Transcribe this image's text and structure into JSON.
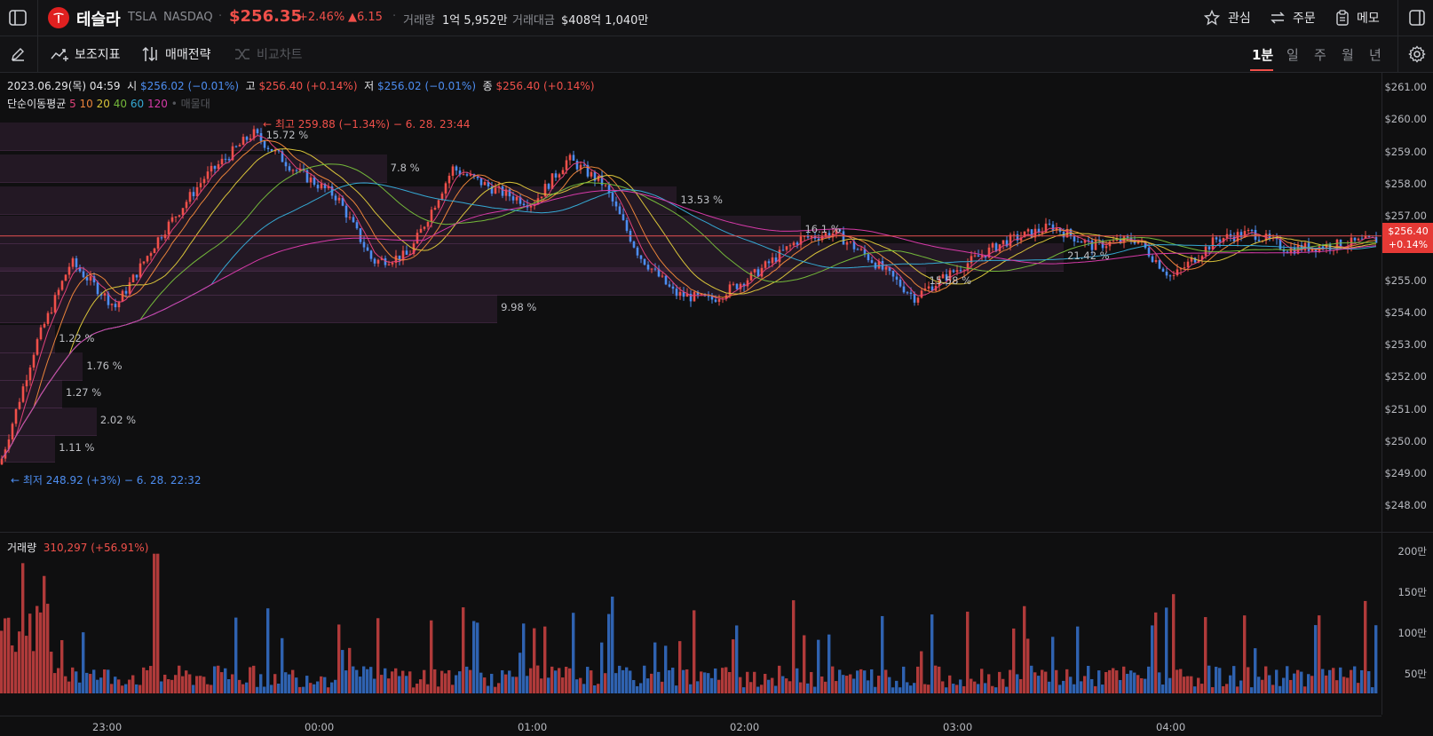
{
  "header": {
    "name": "테슬라",
    "ticker": "TSLA",
    "exchange": "NASDAQ",
    "price": "$256.35",
    "change_pct": "+2.46%",
    "change_abs": "▲6.15",
    "volume_label": "거래량",
    "volume_value": "1억 5,952만",
    "amount_label": "거래대금",
    "amount_value": "$408억 1,040만",
    "actions": [
      {
        "label": "관심",
        "icon": "star-icon"
      },
      {
        "label": "주문",
        "icon": "swap-arrows-icon"
      },
      {
        "label": "메모",
        "icon": "clipboard-icon"
      }
    ]
  },
  "toolbar": {
    "indicators": "보조지표",
    "strategy": "매매전략",
    "compare": "비교차트",
    "timeframes": [
      "1분",
      "일",
      "주",
      "월",
      "년"
    ],
    "active_timeframe": "1분"
  },
  "ohlc": {
    "date": "2023.06.29(목) 04:59",
    "open_label": "시",
    "open": "$256.02 (−0.01%)",
    "high_label": "고",
    "high": "$256.40 (+0.14%)",
    "low_label": "저",
    "low": "$256.02 (−0.01%)",
    "close_label": "종",
    "close": "$256.40 (+0.14%)"
  },
  "ma_legend": {
    "label": "단순이동평균",
    "periods": [
      "5",
      "10",
      "20",
      "40",
      "60",
      "120"
    ],
    "extra": "• 매물대"
  },
  "colors": {
    "ma5": "#e0427a",
    "ma10": "#e9833a",
    "ma20": "#d9c43a",
    "ma40": "#74b83a",
    "ma60": "#35a9d4",
    "ma120": "#d63aa8",
    "up": "#f0504a",
    "down": "#4d8df0",
    "band": "#6e3c6e"
  },
  "annotations": {
    "high": "← 최고 259.88 (−1.34%) − 6. 28. 23:44",
    "low": "← 최저 248.92 (+3%) − 6. 28. 22:32"
  },
  "volume_profile": [
    {
      "pct": "15.72 %",
      "price": 259.5,
      "value": 0.19
    },
    {
      "pct": "7.8 %",
      "price": 258.5,
      "value": 0.28
    },
    {
      "pct": "13.53 %",
      "price": 257.5,
      "value": 0.49
    },
    {
      "pct": "16.1 %",
      "price": 256.6,
      "value": 0.58
    },
    {
      "pct": "21.42 %",
      "price": 255.75,
      "value": 0.77
    },
    {
      "pct": "15.58 %",
      "price": 255.0,
      "value": 0.67
    },
    {
      "pct": "9.98 %",
      "price": 254.15,
      "value": 0.36
    },
    {
      "pct": "1.22 %",
      "price": 253.2,
      "value": 0.04
    },
    {
      "pct": "1.76 %",
      "price": 252.35,
      "value": 0.06
    },
    {
      "pct": "1.27 %",
      "price": 251.5,
      "value": 0.045
    },
    {
      "pct": "2.02 %",
      "price": 250.65,
      "value": 0.07
    },
    {
      "pct": "1.11 %",
      "price": 249.8,
      "value": 0.04
    }
  ],
  "price_axis": [
    "$261.00",
    "$260.00",
    "$259.00",
    "$258.00",
    "$257.00",
    "$256.00",
    "$255.00",
    "$254.00",
    "$253.00",
    "$252.00",
    "$251.00",
    "$250.00",
    "$249.00",
    "$248.00"
  ],
  "current_price_tag": {
    "price": "$256.40",
    "change": "+0.14%",
    "value": 256.4
  },
  "volume": {
    "label": "거래량",
    "value": "310,297 (+56.91%)",
    "axis": [
      "200만",
      "150만",
      "100만",
      "50만"
    ]
  },
  "time_axis": [
    "23:00",
    "00:00",
    "01:00",
    "02:00",
    "03:00",
    "04:00"
  ]
}
